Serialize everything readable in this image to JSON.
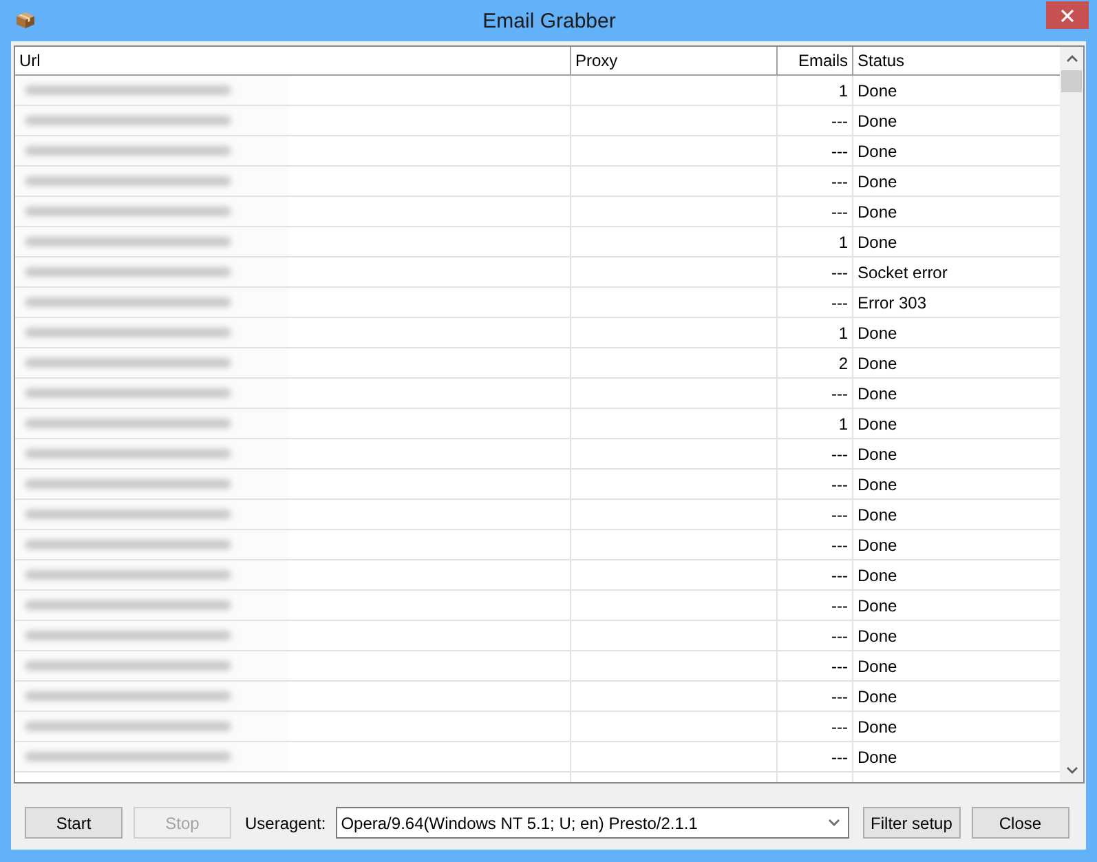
{
  "window": {
    "title": "Email Grabber"
  },
  "table": {
    "columns": [
      "Url",
      "Proxy",
      "Emails",
      "Status"
    ],
    "rows": [
      {
        "emails": "1",
        "status": "Done"
      },
      {
        "emails": "---",
        "status": "Done"
      },
      {
        "emails": "---",
        "status": "Done"
      },
      {
        "emails": "---",
        "status": "Done"
      },
      {
        "emails": "---",
        "status": "Done"
      },
      {
        "emails": "1",
        "status": "Done"
      },
      {
        "emails": "---",
        "status": "Socket error"
      },
      {
        "emails": "---",
        "status": "Error 303"
      },
      {
        "emails": "1",
        "status": "Done"
      },
      {
        "emails": "2",
        "status": "Done"
      },
      {
        "emails": "---",
        "status": "Done"
      },
      {
        "emails": "1",
        "status": "Done"
      },
      {
        "emails": "---",
        "status": "Done"
      },
      {
        "emails": "---",
        "status": "Done"
      },
      {
        "emails": "---",
        "status": "Done"
      },
      {
        "emails": "---",
        "status": "Done"
      },
      {
        "emails": "---",
        "status": "Done"
      },
      {
        "emails": "---",
        "status": "Done"
      },
      {
        "emails": "---",
        "status": "Done"
      },
      {
        "emails": "---",
        "status": "Done"
      },
      {
        "emails": "---",
        "status": "Done"
      },
      {
        "emails": "---",
        "status": "Done"
      },
      {
        "emails": "---",
        "status": "Done"
      }
    ]
  },
  "controls": {
    "buttons_left": [
      {
        "label": "Start",
        "disabled": false
      },
      {
        "label": "Stop",
        "disabled": true
      }
    ],
    "useragent": {
      "label": "Useragent:",
      "value": "Opera/9.64(Windows NT 5.1; U; en) Presto/2.1.1"
    },
    "buttons_right": [
      {
        "label": "Filter setup",
        "disabled": false
      },
      {
        "label": "Close",
        "disabled": false
      }
    ]
  }
}
